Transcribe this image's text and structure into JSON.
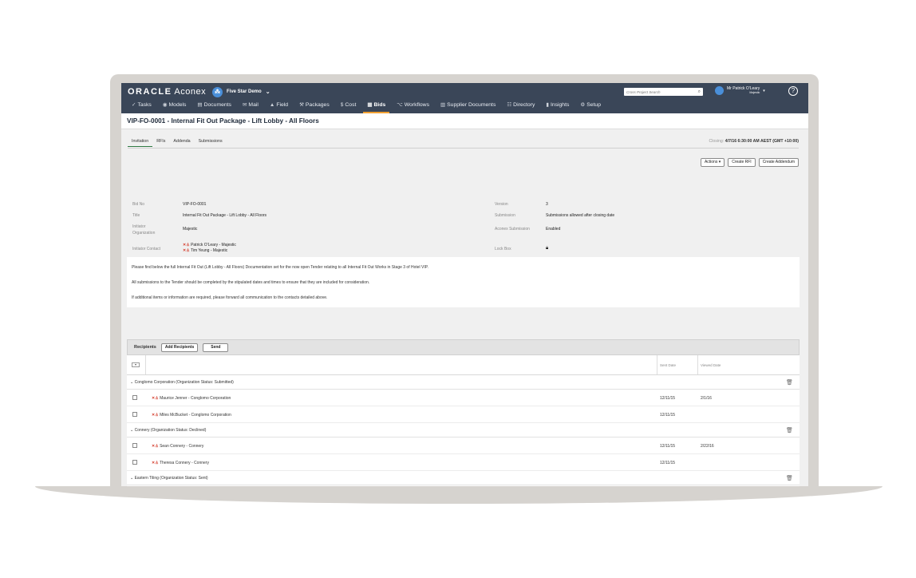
{
  "app": {
    "logo_brand": "ORACLE",
    "logo_product": "Aconex",
    "project_name": "Five Star Demo",
    "search_placeholder": "Cross Project Search",
    "user_name": "Mr Patrick O'Leary",
    "user_org": "Majestic",
    "help_glyph": "?"
  },
  "nav": [
    {
      "icon": "✓",
      "label": "Tasks"
    },
    {
      "icon": "◉",
      "label": "Models"
    },
    {
      "icon": "▤",
      "label": "Documents"
    },
    {
      "icon": "✉",
      "label": "Mail"
    },
    {
      "icon": "▲",
      "label": "Field"
    },
    {
      "icon": "⚒",
      "label": "Packages"
    },
    {
      "icon": "$",
      "label": "Cost"
    },
    {
      "icon": "▦",
      "label": "Bids"
    },
    {
      "icon": "⌥",
      "label": "Workflows"
    },
    {
      "icon": "▥",
      "label": "Supplier Documents"
    },
    {
      "icon": "☷",
      "label": "Directory"
    },
    {
      "icon": "▮",
      "label": "Insights"
    },
    {
      "icon": "⚙",
      "label": "Setup"
    }
  ],
  "page": {
    "title": "VIP-FO-0001 - Internal Fit Out Package - Lift Lobby - All Floors",
    "tabs": [
      "Invitation",
      "RFIs",
      "Addenda",
      "Submissions"
    ],
    "closing_label": "Closing:",
    "closing_value": "4/7/16 6:30:00 AM AEST (GMT +10:00)",
    "actions_label": "Actions ▾",
    "create_rfi_label": "Create RFI",
    "create_addendum_label": "Create Addendum"
  },
  "details": {
    "bid_no_label": "Bid No",
    "bid_no": "VIP-FO-0001",
    "title_label": "Title",
    "title": "Internal Fit Out Package - Lift Lobby - All Floors",
    "initiator_org_label_1": "Initiator",
    "initiator_org_label_2": "Organization",
    "initiator_org": "Majestic",
    "initiator_contact_label": "Initiator Contact",
    "contact_1": "Patrick O'Leary - Majestic",
    "contact_2": "Tim Yeung - Majestic",
    "version_label": "Version",
    "version": "3",
    "submission_label": "Submission",
    "submission": "Submissions allowed after closing date",
    "aconex_submission_label": "Aconex Submission",
    "aconex_submission": "Enabled",
    "lock_box_label": "Lock Box"
  },
  "description": [
    "Please find below the full Internal Fit Out (Lift Lobby - All Floors) Documentation set for the now open Tender relating to all Internal Fit Out Works in Stage 3 of Hotel VIP.",
    "All submissions to the Tender should be completed by the stipulated dates and times to ensure that they are included for consideration.",
    "If additional items or information are required, please forward all communication to the contacts detailed above."
  ],
  "recipients": {
    "label": "Recipients",
    "add_label": "Add Recipients",
    "send_label": "Send",
    "sent_date_header": "Sent Date",
    "viewed_date_header": "Viewed Date",
    "groups": [
      {
        "title": "Conglomo Corporation (Organization Status: Submitted)",
        "rows": [
          {
            "name": "Maurice Jenner - Conglomo Corporation",
            "sent": "12/11/15",
            "viewed": "2/1/16"
          },
          {
            "name": "Miles McBucket - Conglomo Corporation",
            "sent": "12/11/15",
            "viewed": ""
          }
        ]
      },
      {
        "title": "Connery (Organization Status: Declined)",
        "rows": [
          {
            "name": "Sean Connery - Connery",
            "sent": "12/11/15",
            "viewed": "2/22/16"
          },
          {
            "name": "Theresa Connery - Connery",
            "sent": "12/11/15",
            "viewed": ""
          }
        ]
      },
      {
        "title": "Eastern Tiling (Organization Status: Sent)",
        "rows": []
      }
    ]
  },
  "colors": {
    "topbar": "#3a4658",
    "accent": "#f1a032",
    "tab_underline": "#2f7a43"
  }
}
